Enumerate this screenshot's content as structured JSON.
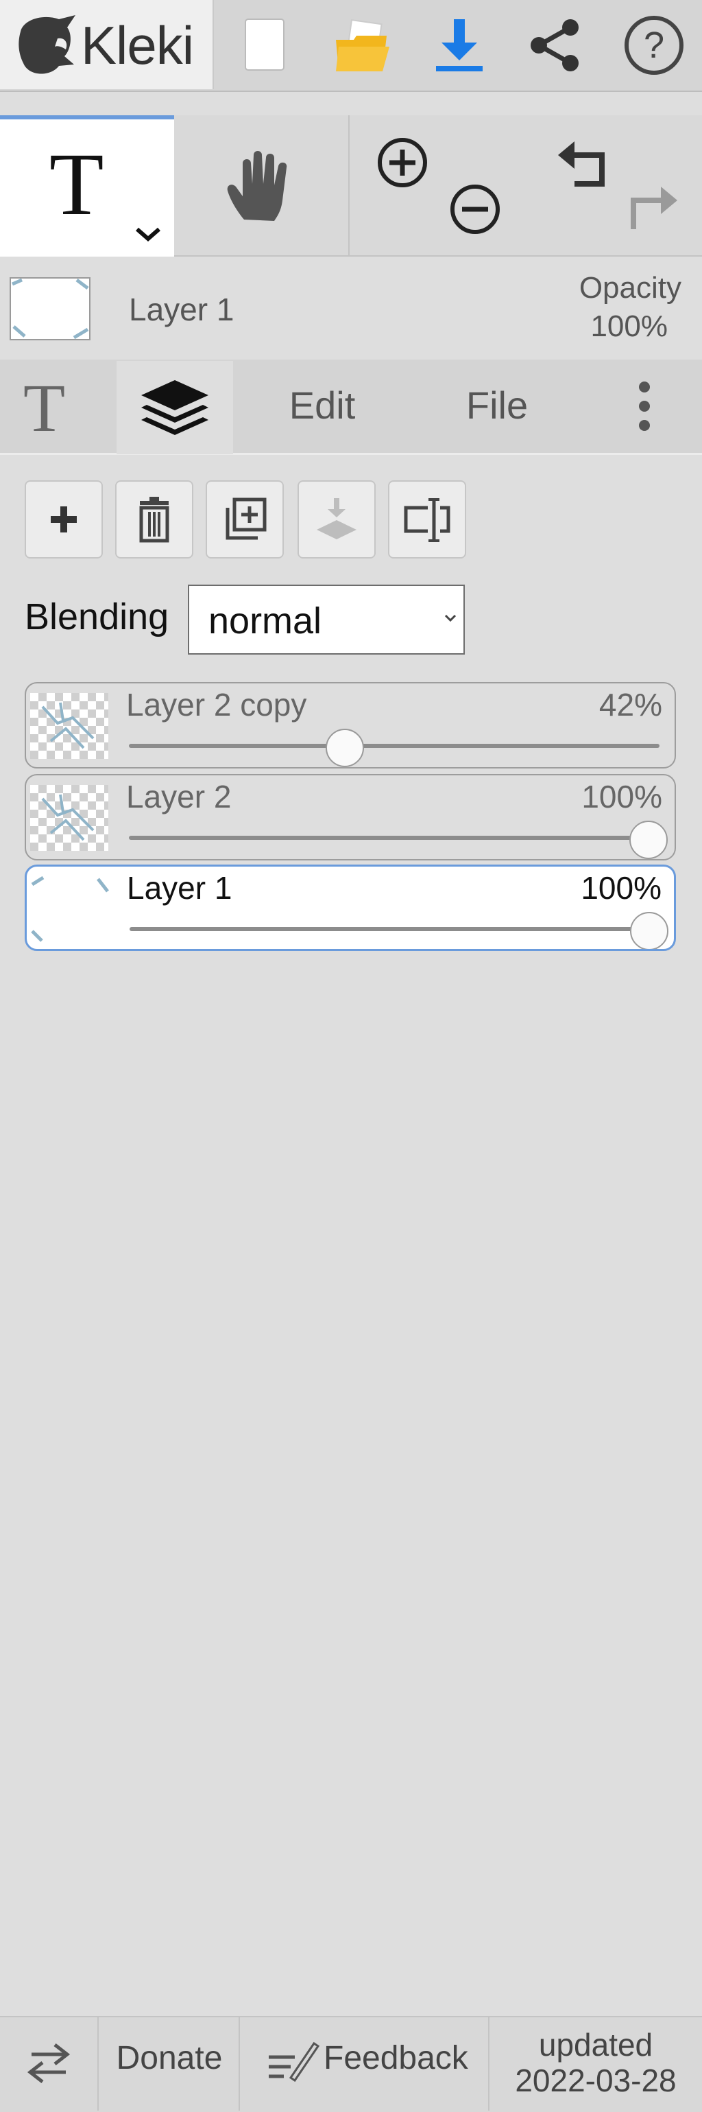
{
  "app": {
    "logo_text": "Kleki"
  },
  "toolbar": {
    "icons": [
      "logo-head-icon",
      "new-document-icon",
      "open-folder-icon",
      "download-icon",
      "share-icon",
      "help-icon"
    ]
  },
  "tools": {
    "active": "text",
    "icons": [
      "text-tool-icon",
      "hand-tool-icon",
      "zoom-in-icon",
      "zoom-out-icon",
      "undo-icon",
      "redo-icon"
    ]
  },
  "current_layer": {
    "name": "Layer 1",
    "opacity_label": "Opacity",
    "opacity_value": "100%"
  },
  "tabs": [
    {
      "label": "T",
      "icon": "text-tab-icon"
    },
    {
      "label": "",
      "icon": "layers-icon",
      "active": true
    },
    {
      "label": "Edit"
    },
    {
      "label": "File"
    },
    {
      "label": "",
      "icon": "more-vertical-icon"
    }
  ],
  "layer_buttons": [
    "add-layer-icon",
    "delete-layer-icon",
    "duplicate-layer-icon",
    "merge-down-icon",
    "rename-layer-icon"
  ],
  "blending": {
    "label": "Blending",
    "value": "normal"
  },
  "layers": [
    {
      "name": "Layer 2 copy",
      "opacity": "42%",
      "opacity_fraction": 0.42,
      "active": false
    },
    {
      "name": "Layer 2",
      "opacity": "100%",
      "opacity_fraction": 1.0,
      "active": false
    },
    {
      "name": "Layer 1",
      "opacity": "100%",
      "opacity_fraction": 1.0,
      "active": true
    }
  ],
  "footer": {
    "donate": "Donate",
    "feedback": "Feedback",
    "updated_label": "updated",
    "updated_date": "2022-03-28"
  },
  "colors": {
    "accent": "#6a9bdc",
    "download": "#1a7be6",
    "folder": "#f2b61d"
  }
}
